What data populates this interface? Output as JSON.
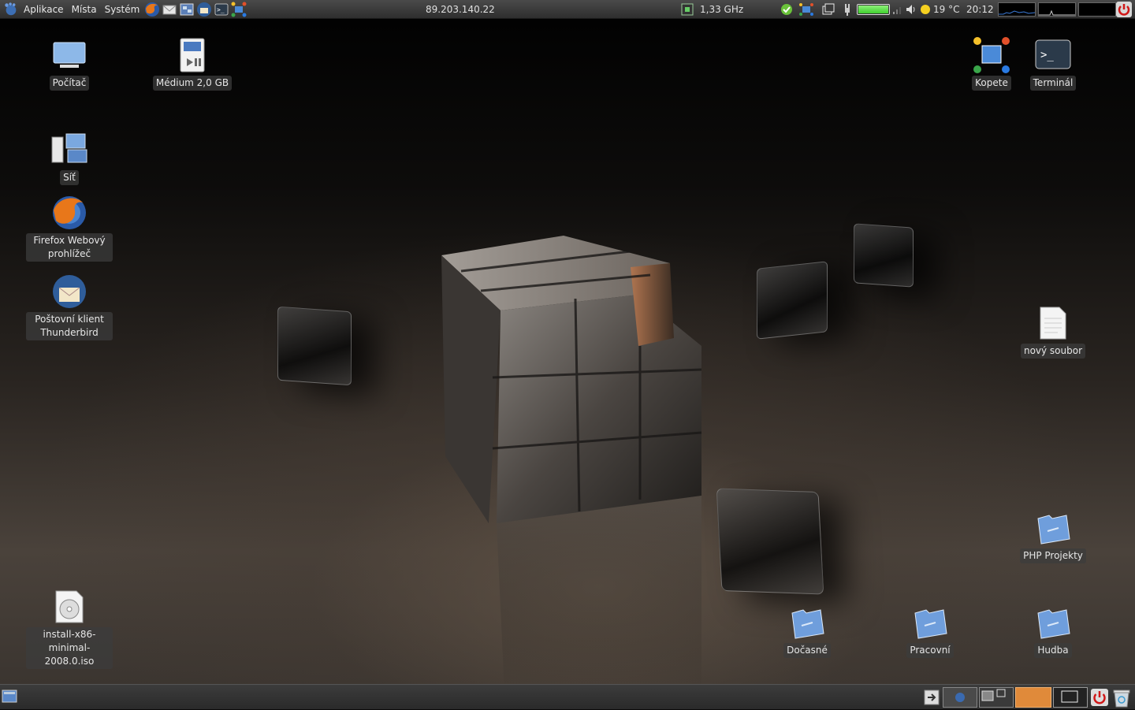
{
  "top_panel": {
    "menus": [
      "Aplikace",
      "Místa",
      "Systém"
    ],
    "launchers": [
      "firefox-icon",
      "mail-icon",
      "screenshot-icon",
      "thunderbird-icon",
      "terminal-icon",
      "network-icon"
    ],
    "ip_address": "89.203.140.22",
    "cpu_freq": "1,33 GHz",
    "weather_temp": "19 °C",
    "clock": "20:12",
    "battery_color": "#3fcf2e"
  },
  "desktop_icons": {
    "computer": "Počítač",
    "medium": "Médium 2,0 GB",
    "network": "Síť",
    "firefox": "Firefox Webový prohlížeč",
    "thunderbird": "Poštovní klient Thunderbird",
    "iso": "install-x86-minimal-2008.0.iso",
    "kopete": "Kopete",
    "terminal": "Terminál",
    "new_file": "nový soubor",
    "php": "PHP Projekty",
    "temp": "Dočasné",
    "work": "Pracovní",
    "music": "Hudba"
  },
  "bottom_panel": {
    "active_workspace_color": "#e08a3a"
  }
}
